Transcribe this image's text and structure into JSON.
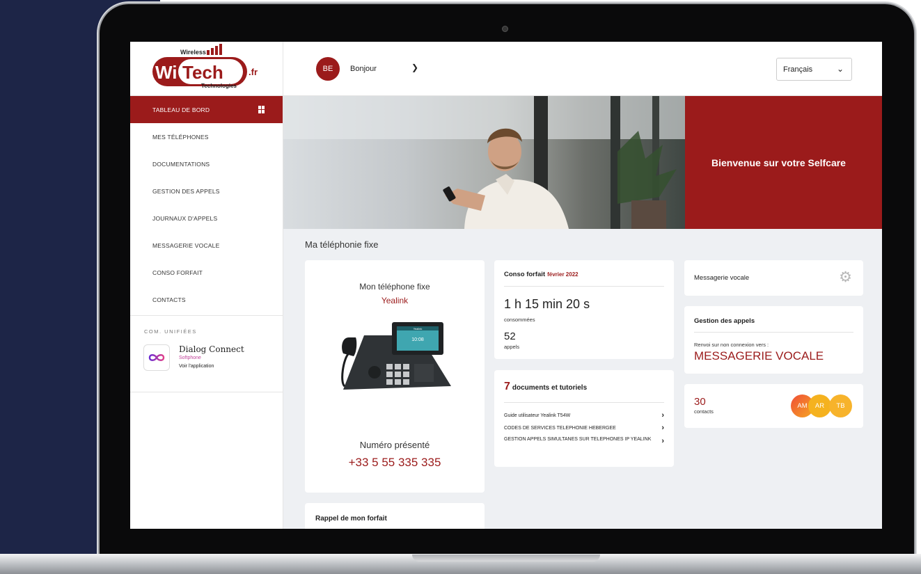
{
  "brand": {
    "name": "Wi Tech",
    "suffix": ".fr",
    "top": "Wireless",
    "bottom": "Technologies"
  },
  "user": {
    "initials": "BE",
    "greeting": "Bonjour"
  },
  "language": {
    "selected": "Français"
  },
  "nav": {
    "items": [
      {
        "label": "TABLEAU DE BORD"
      },
      {
        "label": "MES TÉLÉPHONES"
      },
      {
        "label": "DOCUMENTATIONS"
      },
      {
        "label": "GESTION DES APPELS"
      },
      {
        "label": "JOURNAUX D'APPELS"
      },
      {
        "label": "MESSAGERIE VOCALE"
      },
      {
        "label": "CONSO FORFAIT"
      },
      {
        "label": "CONTACTS"
      }
    ]
  },
  "com": {
    "title": "COM. UNIFIÉES",
    "app_name": "Dialog Connect",
    "app_type": "Softphone",
    "app_link": "Voir l'application"
  },
  "banner": {
    "title": "Bienvenue sur votre Selfcare"
  },
  "section": {
    "title": "Ma téléphonie fixe"
  },
  "phone": {
    "title": "Mon téléphone fixe",
    "brand": "Yealink",
    "screen_brand": "Yealink",
    "screen_time": "10:08",
    "number_label": "Numéro présenté",
    "number": "+33 5 55 335 335"
  },
  "rappel": {
    "title": "Rappel de mon forfait"
  },
  "conso": {
    "title": "Conso forfait",
    "month": "février 2022",
    "time": "1 h 15 min 20 s",
    "time_label": "consommées",
    "calls": "52",
    "calls_label": "appels"
  },
  "docs": {
    "count": "7",
    "title": "documents et tutoriels",
    "items": [
      {
        "label": "Guide utilisateur Yealink T54W"
      },
      {
        "label": "CODES DE SERVICES TELEPHONIE HEBERGEE"
      },
      {
        "label": "GESTION APPELS SIMULTANES SUR TELEPHONES IP YEALINK"
      }
    ]
  },
  "messagerie": {
    "title": "Messagerie vocale"
  },
  "gestion": {
    "title": "Gestion des appels",
    "sub": "Renvoi sur non connexion vers :",
    "value": "MESSAGERIE VOCALE"
  },
  "contacts": {
    "count": "30",
    "label": "contacts",
    "avatars": [
      {
        "initials": "AM",
        "color": "#f04e37"
      },
      {
        "initials": "AR",
        "color": "#f5a623"
      },
      {
        "initials": "TB",
        "color": "#f7b32b"
      }
    ]
  },
  "colors": {
    "accent": "#9b1b1b",
    "background": "#eef0f3",
    "backdrop": "#1d2547"
  },
  "icons": {
    "nav_active": "dashboard-grid-icon",
    "dropdown": "chevron-down-icon",
    "settings": "gear-icon",
    "doc_link": "chevron-right-icon",
    "app": "infinity-icon"
  }
}
